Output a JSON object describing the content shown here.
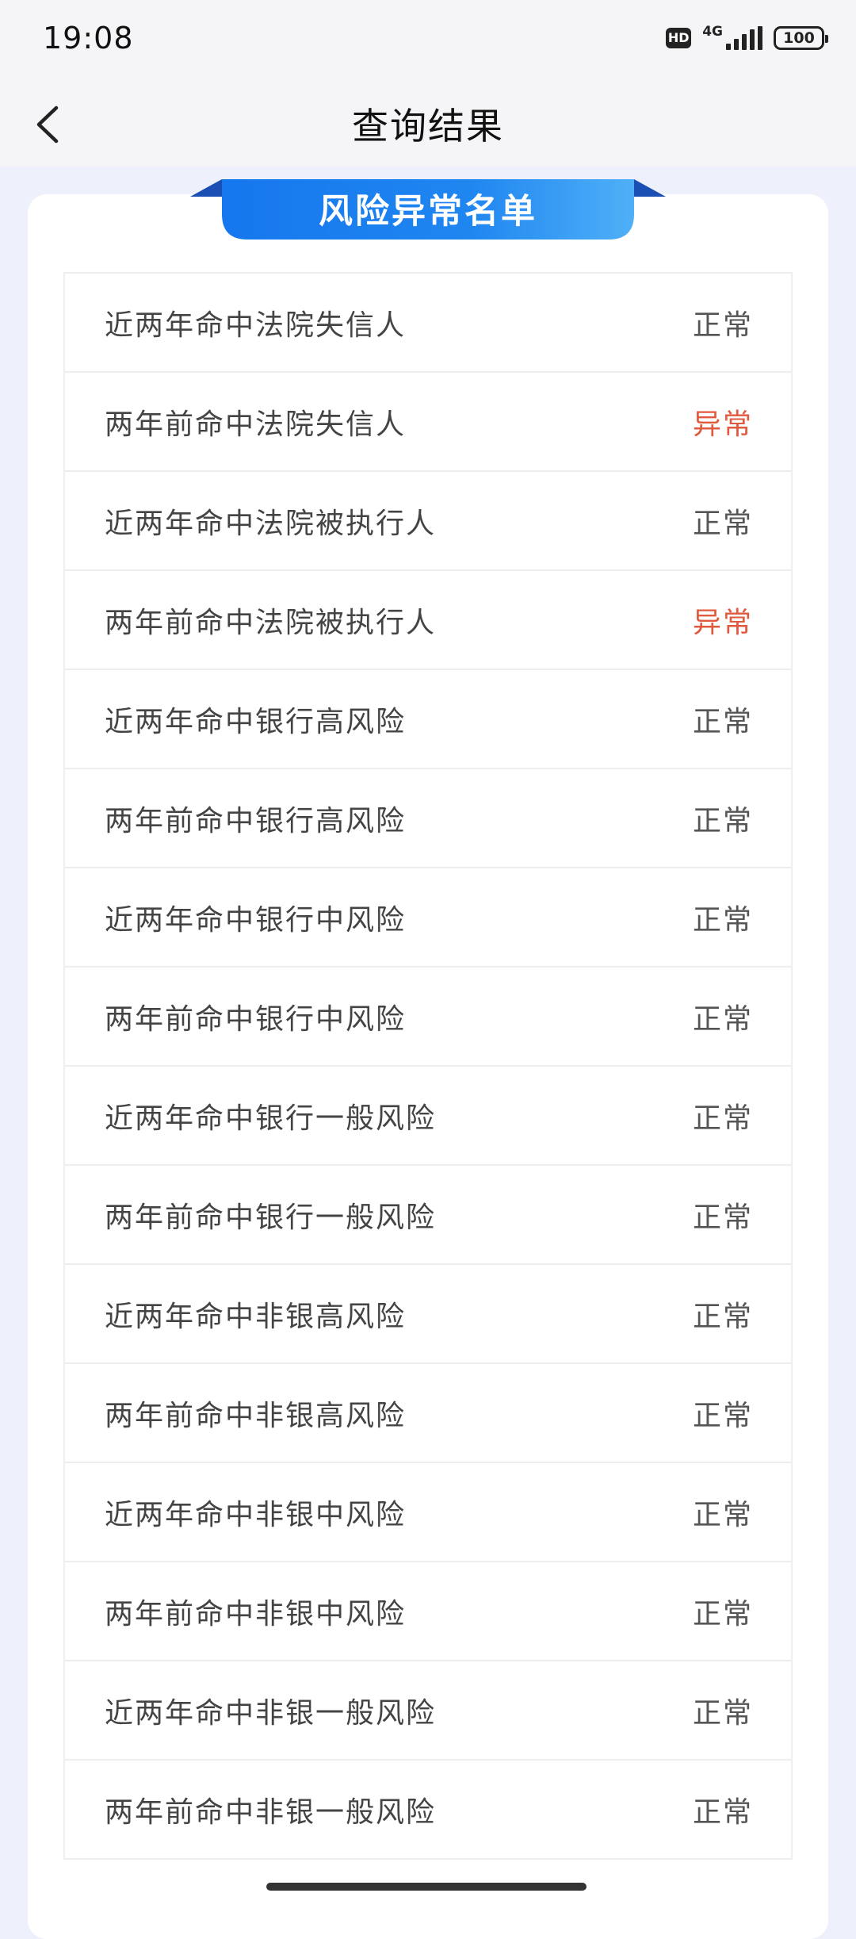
{
  "status_bar": {
    "time": "19:08",
    "hd_badge": "HD",
    "network": "4G",
    "battery": "100"
  },
  "header": {
    "back_icon": "chevron-left-icon",
    "title": "查询结果"
  },
  "card": {
    "ribbon_title": "风险异常名单",
    "ribbon_color": "#1f86f0",
    "abnormal_color": "#e15a3f",
    "rows": [
      {
        "label": "近两年命中法院失信人",
        "status": "正常",
        "abnormal": false
      },
      {
        "label": "两年前命中法院失信人",
        "status": "异常",
        "abnormal": true
      },
      {
        "label": "近两年命中法院被执行人",
        "status": "正常",
        "abnormal": false
      },
      {
        "label": "两年前命中法院被执行人",
        "status": "异常",
        "abnormal": true
      },
      {
        "label": "近两年命中银行高风险",
        "status": "正常",
        "abnormal": false
      },
      {
        "label": "两年前命中银行高风险",
        "status": "正常",
        "abnormal": false
      },
      {
        "label": "近两年命中银行中风险",
        "status": "正常",
        "abnormal": false
      },
      {
        "label": "两年前命中银行中风险",
        "status": "正常",
        "abnormal": false
      },
      {
        "label": "近两年命中银行一般风险",
        "status": "正常",
        "abnormal": false
      },
      {
        "label": "两年前命中银行一般风险",
        "status": "正常",
        "abnormal": false
      },
      {
        "label": "近两年命中非银高风险",
        "status": "正常",
        "abnormal": false
      },
      {
        "label": "两年前命中非银高风险",
        "status": "正常",
        "abnormal": false
      },
      {
        "label": "近两年命中非银中风险",
        "status": "正常",
        "abnormal": false
      },
      {
        "label": "两年前命中非银中风险",
        "status": "正常",
        "abnormal": false
      },
      {
        "label": "近两年命中非银一般风险",
        "status": "正常",
        "abnormal": false
      },
      {
        "label": "两年前命中非银一般风险",
        "status": "正常",
        "abnormal": false
      }
    ]
  }
}
